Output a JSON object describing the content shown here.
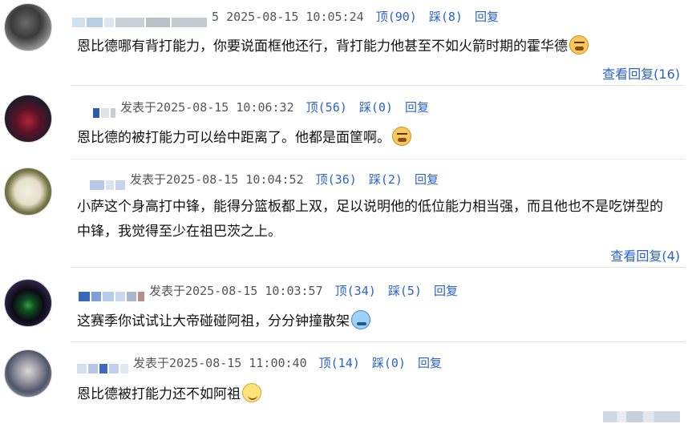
{
  "labels": {
    "posted_at": "发表于",
    "up": "顶",
    "down": "踩",
    "reply": "回复"
  },
  "comments": [
    {
      "posted_prefix": "5",
      "datetime": "2025-08-15 10:05:24",
      "up": "(90)",
      "down": "(8)",
      "text": "恩比德哪有背打能力，你要说面框他还行，背打能力他甚至不如火箭时期的霍华德",
      "emoji": "sweat-face-icon",
      "view_replies": "查看回复(16)"
    },
    {
      "datetime": "2025-08-15 10:06:32",
      "up": "(56)",
      "down": "(0)",
      "text": "恩比德的被打能力可以给中距离了。他都是面筐啊。",
      "emoji": "sweat-face-icon"
    },
    {
      "datetime": "2025-08-15 10:04:52",
      "up": "(36)",
      "down": "(2)",
      "text_line1": "小萨这个身高打中锋，能得分篮板都上双，足以说明他的低位能力相当强，而且他也不是吃饼型的",
      "text_line2": "中锋，我觉得至少在祖巴茨之上。",
      "view_replies": "查看回复(4)"
    },
    {
      "posted_prefix": "发表于",
      "datetime": "2025-08-15 10:03:57",
      "up": "(34)",
      "down": "(5)",
      "text": "这赛季你试试让大帝碰碰阿祖，分分钟撞散架",
      "emoji": "cold-sweat-face-icon"
    },
    {
      "datetime": "2025-08-15 11:00:40",
      "up": "(14)",
      "down": "(0)",
      "text": "恩比德被打能力还不如阿祖",
      "emoji": "smile-face-icon"
    }
  ]
}
